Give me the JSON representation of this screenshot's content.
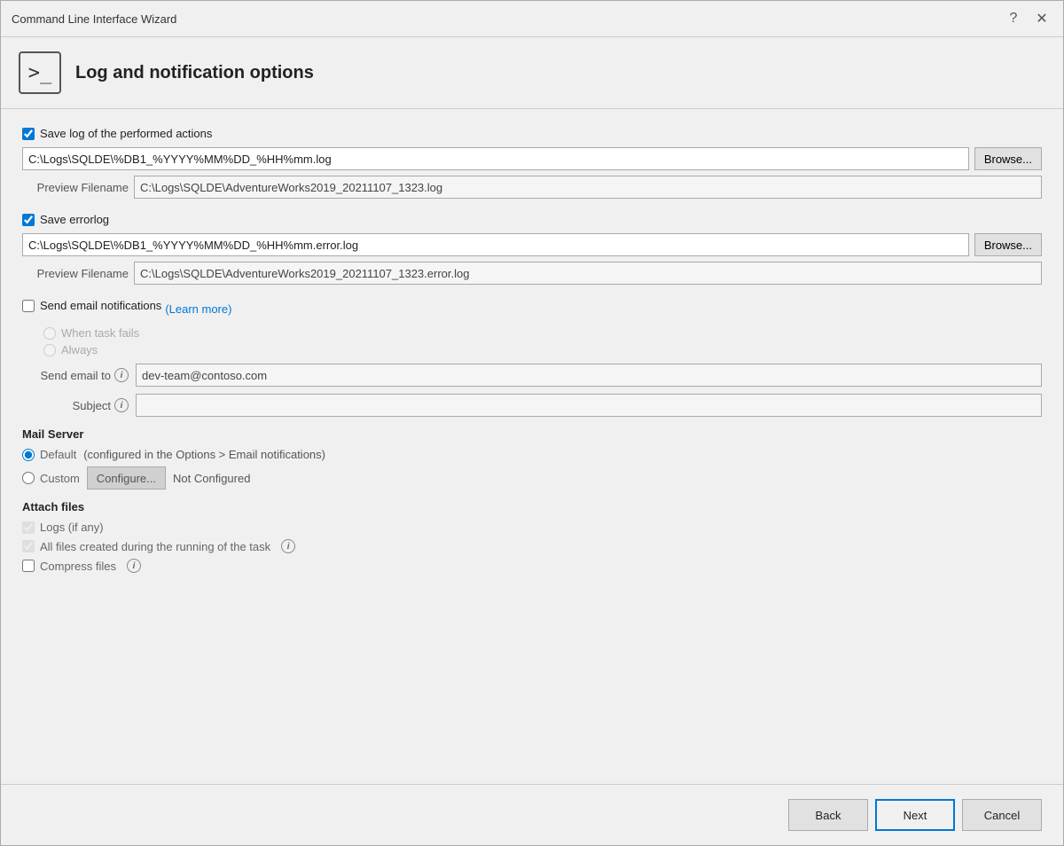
{
  "window": {
    "title": "Command Line Interface Wizard",
    "help_btn": "?",
    "close_btn": "✕"
  },
  "header": {
    "icon": ">_",
    "title": "Log and notification options"
  },
  "log_section": {
    "save_log_label": "Save log of the performed actions",
    "save_log_checked": true,
    "log_path": "C:\\Logs\\SQLDE\\%DB1_%YYYY%MM%DD_%HH%mm.log",
    "browse_label": "Browse...",
    "preview_label": "Preview Filename",
    "preview_value": "C:\\Logs\\SQLDE\\AdventureWorks2019_20211107_1323.log"
  },
  "errorlog_section": {
    "save_errorlog_label": "Save errorlog",
    "save_errorlog_checked": true,
    "errorlog_path": "C:\\Logs\\SQLDE\\%DB1_%YYYY%MM%DD_%HH%mm.error.log",
    "browse_label": "Browse...",
    "preview_label": "Preview Filename",
    "preview_value": "C:\\Logs\\SQLDE\\AdventureWorks2019_20211107_1323.error.log"
  },
  "email_section": {
    "send_email_label": "Send email notifications",
    "send_email_checked": false,
    "learn_more_label": "(Learn more)",
    "learn_more_url": "#",
    "when_fails_label": "When task fails",
    "always_label": "Always",
    "send_to_label": "Send email to",
    "send_to_value": "dev-team@contoso.com",
    "subject_label": "Subject",
    "subject_value": ""
  },
  "mail_server": {
    "heading": "Mail Server",
    "default_label": "Default",
    "default_desc": "(configured in the Options > Email notifications)",
    "custom_label": "Custom",
    "configure_label": "Configure...",
    "not_configured": "Not Configured"
  },
  "attach_files": {
    "heading": "Attach files",
    "logs_label": "Logs (if any)",
    "logs_checked": true,
    "all_files_label": "All files created during the running of the task",
    "all_files_checked": true,
    "compress_label": "Compress files",
    "compress_checked": false
  },
  "footer": {
    "back_label": "Back",
    "next_label": "Next",
    "cancel_label": "Cancel"
  }
}
